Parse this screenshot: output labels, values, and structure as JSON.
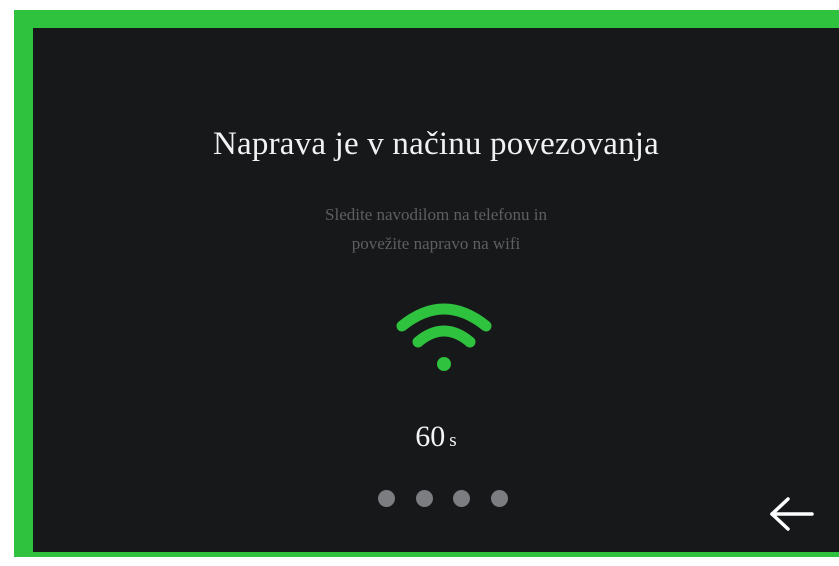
{
  "screen": {
    "title": "Naprava je v načinu povezovanja",
    "subtitle_line1": "Sledite navodilom na telefonu in",
    "subtitle_line2": "povežite napravo na wifi",
    "timer_value": "60",
    "timer_unit": "s",
    "wifi_icon": "wifi-icon",
    "back_icon": "back-arrow-icon",
    "pager_dots": 4,
    "colors": {
      "border": "#2ec23e",
      "background": "#17181a",
      "wifi": "#2ec23e",
      "dot": "#7b7d81",
      "title": "#f2f2f2",
      "subtitle": "#5e5f62"
    }
  }
}
